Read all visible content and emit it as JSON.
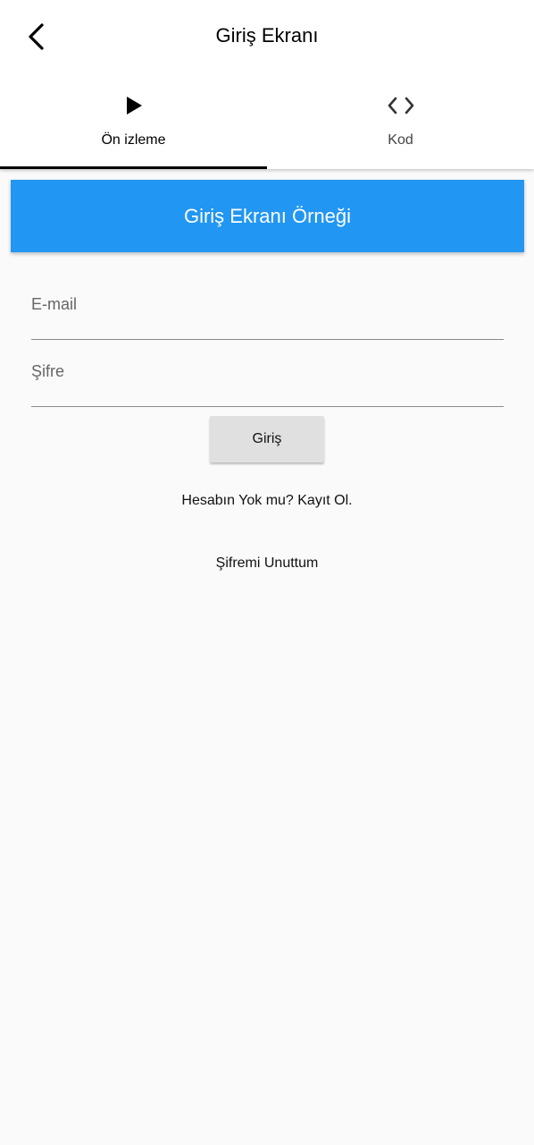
{
  "app_bar": {
    "title": "Giriş Ekranı",
    "back_icon": "chevron-left-icon"
  },
  "tabs": [
    {
      "label": "Ön izleme",
      "icon": "play-icon",
      "active": true
    },
    {
      "label": "Kod",
      "icon": "code-icon",
      "active": false
    }
  ],
  "banner": {
    "title": "Giriş Ekranı Örneği",
    "color": "#2196f3"
  },
  "form": {
    "email_placeholder": "E-mail",
    "password_placeholder": "Şifre",
    "login_label": "Giriş",
    "register_link": "Hesabın Yok mu? Kayıt Ol.",
    "forgot_link": "Şifremi Unuttum"
  }
}
